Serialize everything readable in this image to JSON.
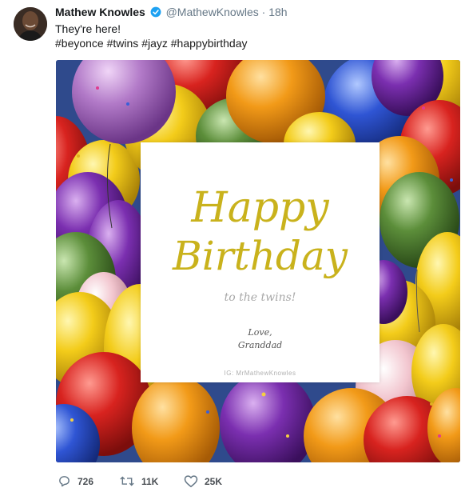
{
  "tweet": {
    "author_name": "Mathew Knowles",
    "handle": "@MathewKnowles",
    "separator": "·",
    "timestamp": "18h",
    "verified_icon": "verified-badge-icon",
    "text": "They're here!",
    "hashtags": [
      "#beyonce",
      "#twins",
      "#jayz",
      "#happybirthday"
    ]
  },
  "image_card": {
    "line1": "Happy",
    "line2": "Birthday",
    "subtitle": "to the twins!",
    "signoff_line1": "Love,",
    "signoff_line2": "Granddad",
    "credit": "IG: MrMathewKnowles"
  },
  "actions": {
    "reply_count": "726",
    "retweet_count": "11K",
    "like_count": "25K",
    "reply_icon": "reply-icon",
    "retweet_icon": "retweet-icon",
    "like_icon": "heart-icon"
  },
  "colors": {
    "accent_blue": "#1da1f2",
    "card_gold": "#c9b21c",
    "muted_gray": "#657786"
  }
}
